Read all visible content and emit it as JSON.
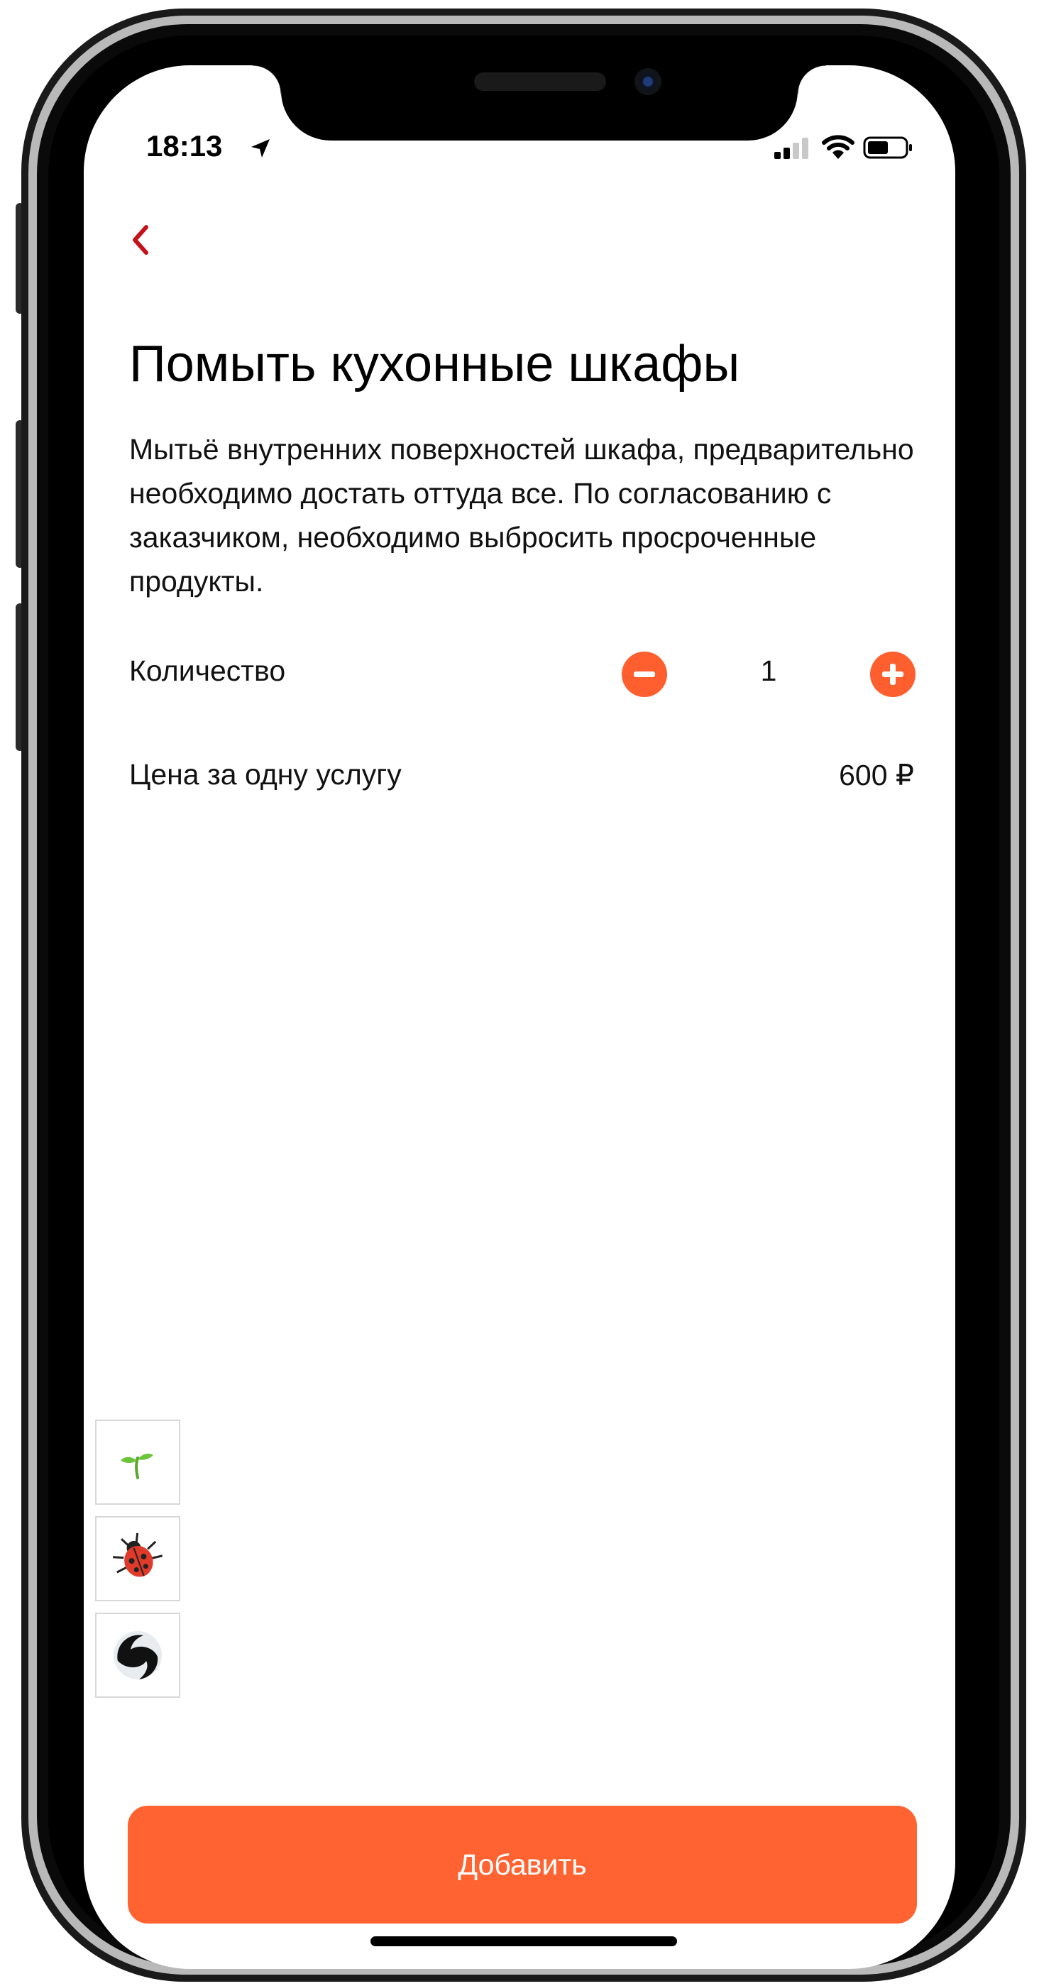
{
  "status_bar": {
    "time": "18:13",
    "location_icon": "location-arrow-icon",
    "signal_icon": "cellular-signal-icon",
    "wifi_icon": "wifi-icon",
    "battery_icon": "battery-icon"
  },
  "nav": {
    "back_icon": "chevron-left-icon"
  },
  "service": {
    "title": "Помыть кухонные шкафы",
    "description": "Мытьё внутренних поверхностей шкафа, предварительно необходимо достать оттуда все. По согласованию с заказчиком, необходимо выбросить просроченные продукты."
  },
  "quantity": {
    "label": "Количество",
    "value": "1",
    "decrease_icon": "minus-circle-icon",
    "increase_icon": "plus-circle-icon"
  },
  "price": {
    "label": "Цена за одну услугу",
    "value": "600 ₽"
  },
  "side_tools": [
    {
      "icon": "sprout-icon"
    },
    {
      "icon": "ladybug-icon"
    },
    {
      "icon": "swirl-icon"
    }
  ],
  "actions": {
    "add_label": "Добавить"
  },
  "colors": {
    "accent": "#ff6331",
    "back_arrow": "#c4121b",
    "text": "#111111"
  }
}
